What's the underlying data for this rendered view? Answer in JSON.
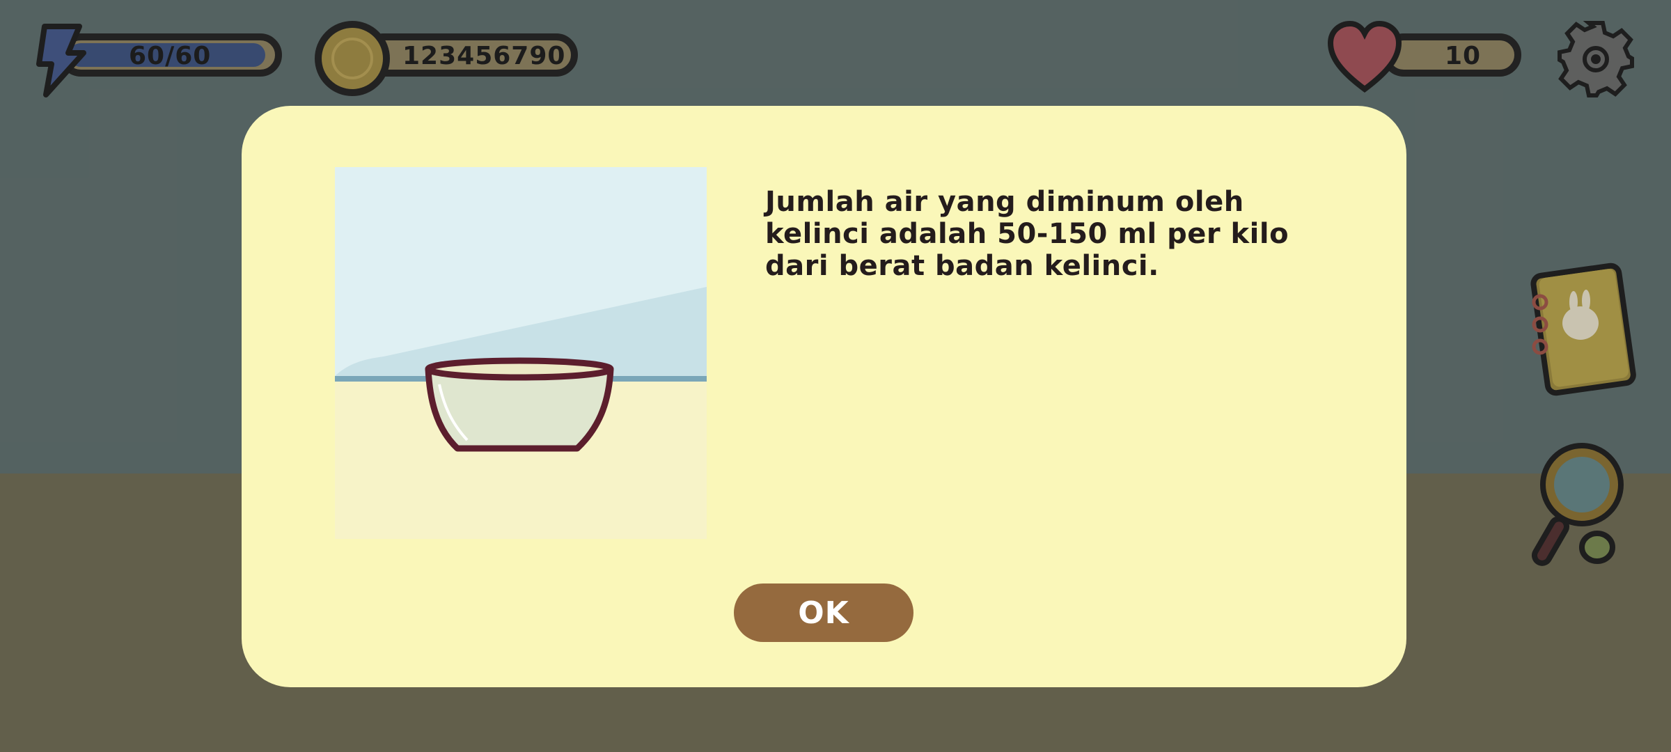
{
  "hud": {
    "energy": "60/60",
    "coins": "123456790",
    "hearts": "10"
  },
  "modal": {
    "fact_text": "Jumlah air yang diminum oleh kelinci adalah 50-150 ml per kilo dari berat badan kelinci.",
    "ok_label": "OK"
  },
  "icons": {
    "energy": "lightning-icon",
    "coin": "rabbit-coin-icon",
    "heart": "heart-icon",
    "settings": "gear-icon",
    "journal": "notebook-icon",
    "search": "magnifier-icon"
  },
  "colors": {
    "modal_bg": "#faf7b9",
    "ok_button": "#956a3e",
    "energy_fill": "#384a70"
  }
}
